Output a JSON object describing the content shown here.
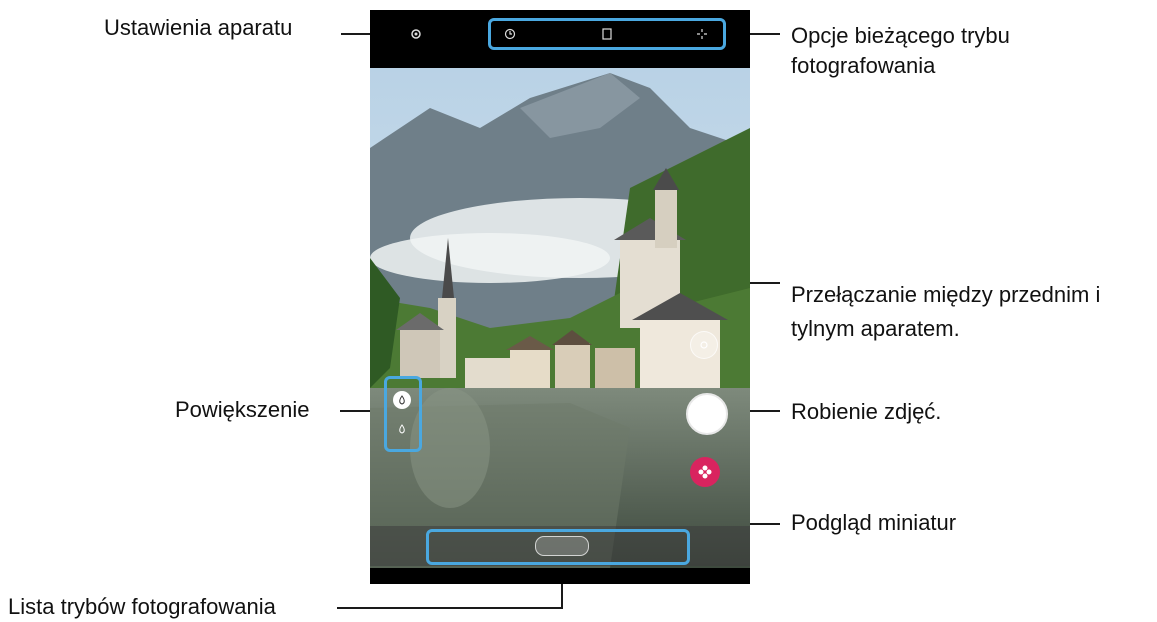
{
  "labels": {
    "camera_settings": "Ustawienia aparatu",
    "mode_options": "Opcje bieżącego trybu fotografowania",
    "switch_camera": "Przełączanie między przednim i tylnym aparatem.",
    "take_picture": "Robienie zdjęć.",
    "zoom": "Powiększenie",
    "preview_thumbnail": "Podgląd miniatur",
    "mode_list": "Lista trybów fotografowania"
  },
  "colors": {
    "callout": "#4aa8e0",
    "thumbnail": "#d9245f",
    "leader_line": "#1a1a1a"
  },
  "icons": {
    "settings": "gear-icon",
    "timer": "timer-icon",
    "ratio": "aspect-ratio-icon",
    "filter": "sparkle-icon",
    "switch": "switch-camera-icon",
    "zoom_wide": "zoom-wide-icon",
    "zoom_normal": "zoom-normal-icon"
  }
}
